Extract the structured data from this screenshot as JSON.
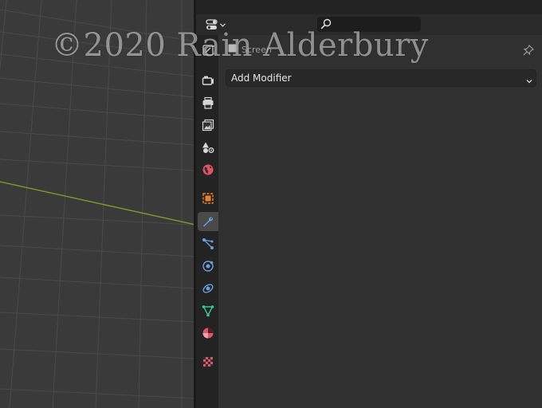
{
  "viewport": {
    "grid_color": "#4a4a4a",
    "axis_color": "#7f9a2c"
  },
  "header": {
    "editor_type_icon": "properties-editor-icon",
    "search": {
      "placeholder": "",
      "value": ""
    }
  },
  "breadcrumb": {
    "context_icon": "screen-icon",
    "label": "Screen"
  },
  "tabs": [
    {
      "name": "tool",
      "icon": "tool-icon",
      "active": false
    },
    {
      "name": "render",
      "icon": "render-camera-icon",
      "active": false
    },
    {
      "name": "output",
      "icon": "printer-output-icon",
      "active": false
    },
    {
      "name": "view-layer",
      "icon": "view-layer-icon",
      "active": false
    },
    {
      "name": "scene",
      "icon": "scene-icon",
      "active": false
    },
    {
      "name": "world",
      "icon": "world-globe-icon",
      "active": false
    },
    {
      "name": "object",
      "icon": "object-square-icon",
      "active": false
    },
    {
      "name": "modifiers",
      "icon": "wrench-icon",
      "active": true
    },
    {
      "name": "particles",
      "icon": "particles-icon",
      "active": false
    },
    {
      "name": "physics",
      "icon": "physics-orbit-icon",
      "active": false
    },
    {
      "name": "constraints",
      "icon": "object-constraint-icon",
      "active": false
    },
    {
      "name": "data",
      "icon": "mesh-data-triangle-icon",
      "active": false
    },
    {
      "name": "material",
      "icon": "material-sphere-icon",
      "active": false
    },
    {
      "name": "texture",
      "icon": "texture-checker-icon",
      "active": false
    }
  ],
  "modifier_panel": {
    "add_modifier_label": "Add Modifier"
  },
  "watermark": {
    "text": "©2020 Rain Alderbury"
  },
  "colors": {
    "active_tab": "#4a4a4a",
    "modifier_blue": "#6a9fdd",
    "object_orange": "#e8822c",
    "world_red": "#e05469",
    "data_green": "#38c6a0"
  }
}
